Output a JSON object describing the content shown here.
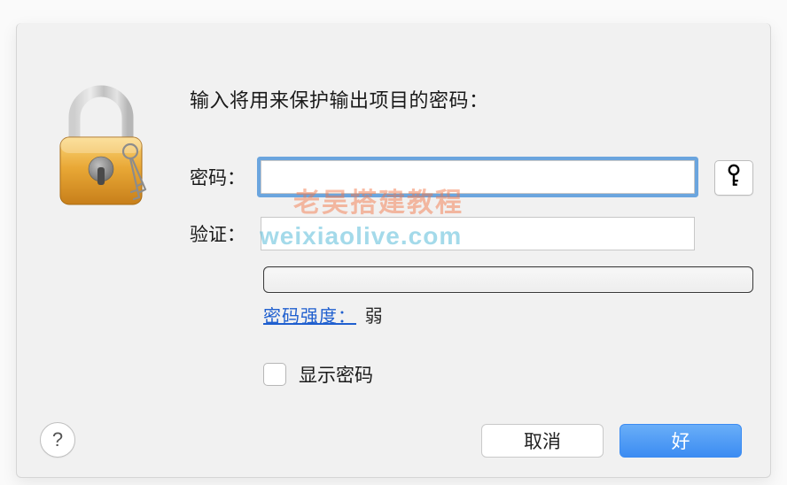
{
  "dialog": {
    "prompt": "输入将用来保护输出项目的密码：",
    "password_label": "密码：",
    "verify_label": "验证：",
    "password_value": "",
    "verify_value": "",
    "strength_label": "密码强度：",
    "strength_value": "弱",
    "show_password_label": "显示密码",
    "show_password_checked": false,
    "cancel_label": "取消",
    "ok_label": "好",
    "help_label": "?"
  },
  "icons": {
    "lock": "lock-icon",
    "key": "key-icon"
  },
  "watermark": {
    "line1": "老吴搭建教程",
    "line2": "weixiaolive.com"
  },
  "colors": {
    "focus_ring": "#5c9ce0",
    "primary_button": "#4a93f3",
    "link": "#1f5fcf"
  }
}
